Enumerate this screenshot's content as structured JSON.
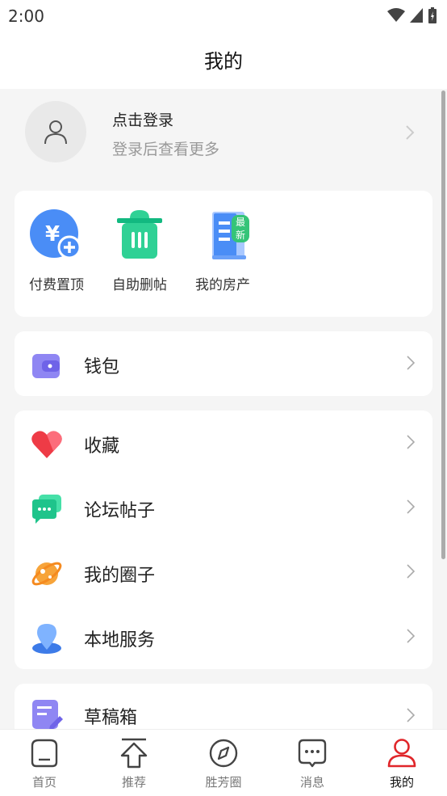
{
  "status": {
    "time": "2:00"
  },
  "header": {
    "title": "我的"
  },
  "profile": {
    "title": "点击登录",
    "subtitle": "登录后查看更多"
  },
  "quick": [
    {
      "label": "付费置顶",
      "icon": "pay-top-icon"
    },
    {
      "label": "自助删帖",
      "icon": "trash-icon"
    },
    {
      "label": "我的房产",
      "icon": "building-icon",
      "badge": "最新"
    }
  ],
  "menu1": [
    {
      "label": "钱包",
      "icon": "wallet-icon"
    }
  ],
  "menu2": [
    {
      "label": "收藏",
      "icon": "heart-icon"
    },
    {
      "label": "论坛帖子",
      "icon": "chat-icon"
    },
    {
      "label": "我的圈子",
      "icon": "planet-icon"
    },
    {
      "label": "本地服务",
      "icon": "location-user-icon"
    }
  ],
  "menu3": [
    {
      "label": "草稿箱",
      "icon": "draft-icon"
    }
  ],
  "tabs": [
    {
      "label": "首页",
      "icon": "home-icon"
    },
    {
      "label": "推荐",
      "icon": "upload-arrow-icon"
    },
    {
      "label": "胜芳圈",
      "icon": "compass-icon"
    },
    {
      "label": "消息",
      "icon": "message-icon"
    },
    {
      "label": "我的",
      "icon": "person-icon",
      "active": true
    }
  ],
  "colors": {
    "accent": "#e0262a",
    "bg": "#f5f5f5"
  }
}
